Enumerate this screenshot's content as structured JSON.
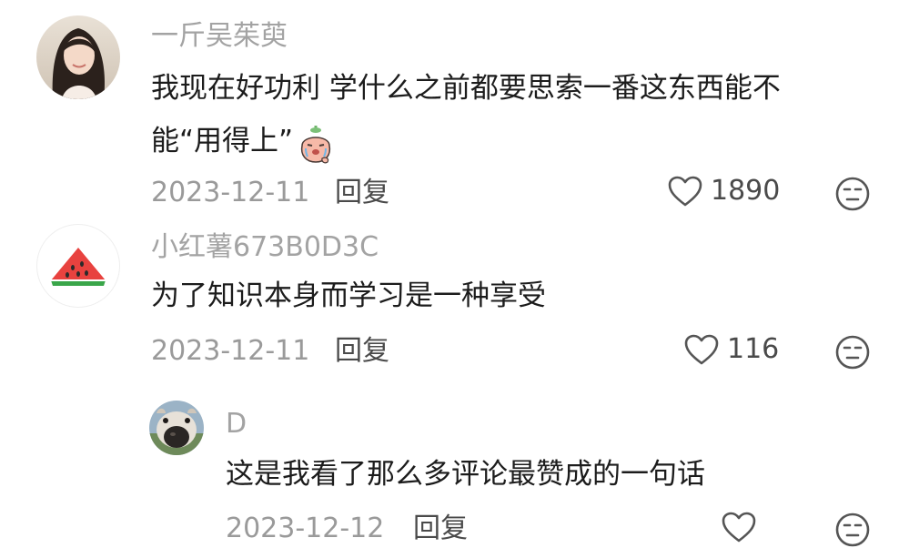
{
  "comments": [
    {
      "username": "一斤吴茱萸",
      "text_line1": "我现在好功利 学什么之前都要思索一番这东西能不",
      "text_line2": "能“用得上”",
      "emoji": "crying-face-sticker",
      "date": "2023-12-11",
      "reply_label": "回复",
      "likes": "1890"
    },
    {
      "username": "小红薯673B0D3C",
      "text": "为了知识本身而学习是一种享受",
      "avatar_icon": "watermelon-icon",
      "date": "2023-12-11",
      "reply_label": "回复",
      "likes": "116"
    },
    {
      "username": "D",
      "text": "这是我看了那么多评论最赞成的一句话",
      "avatar_icon": "dog-avatar",
      "date": "2023-12-12",
      "reply_label": "回复",
      "likes": ""
    }
  ],
  "colors": {
    "username": "#a3a3a3",
    "text": "#1c1c1c",
    "date": "#9a9a9a",
    "action": "#4a4a4a",
    "watermelon_red": "#e8423f",
    "watermelon_green": "#3aa64a"
  }
}
